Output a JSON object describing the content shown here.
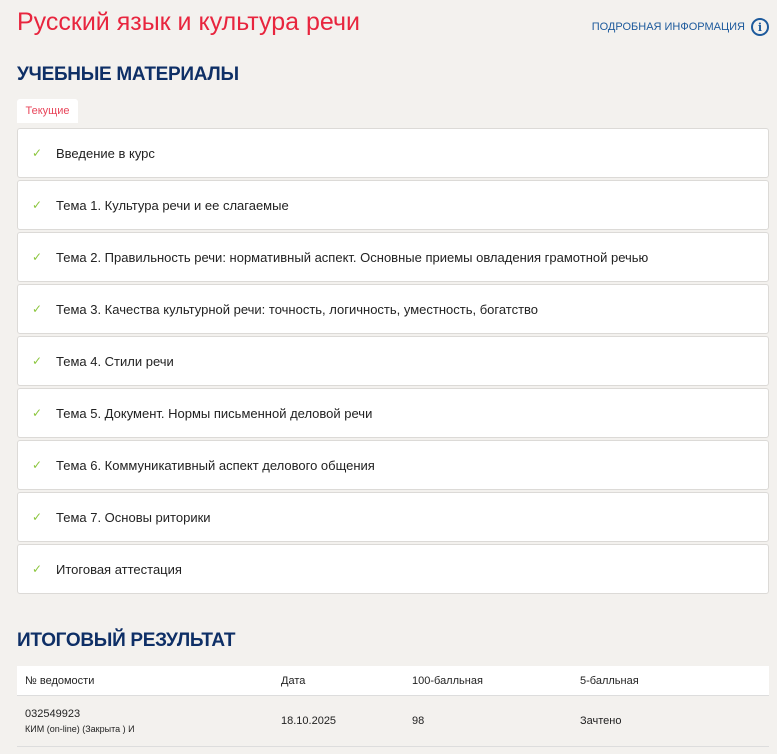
{
  "header": {
    "title": "Русский язык и культура речи",
    "info_link": "ПОДРОБНАЯ ИНФОРМАЦИЯ",
    "info_icon": "i"
  },
  "materials": {
    "heading": "УЧЕБНЫЕ МАТЕРИАЛЫ",
    "tab": "Текущие",
    "check": "✓",
    "items": [
      "Введение в курс",
      "Тема 1. Культура речи и ее слагаемые",
      "Тема 2. Правильность речи: нормативный аспект. Основные приемы овладения грамотной речью",
      "Тема 3. Качества культурной речи: точность, логичность, уместность, богатство",
      "Тема 4. Стили речи",
      "Тема 5. Документ. Нормы письменной деловой речи",
      "Тема 6. Коммуникативный аспект делового общения",
      "Тема 7. Основы риторики",
      "Итоговая аттестация"
    ]
  },
  "results": {
    "heading": "ИТОГОВЫЙ РЕЗУЛЬТАТ",
    "columns": [
      "№ ведомости",
      "Дата",
      "100-балльная",
      "5-балльная"
    ],
    "rows": [
      {
        "number": "032549923",
        "note": "КИМ (on-line) (Закрыта ) И",
        "date": "18.10.2025",
        "score100": "98",
        "score5": "Зачтено"
      }
    ]
  }
}
